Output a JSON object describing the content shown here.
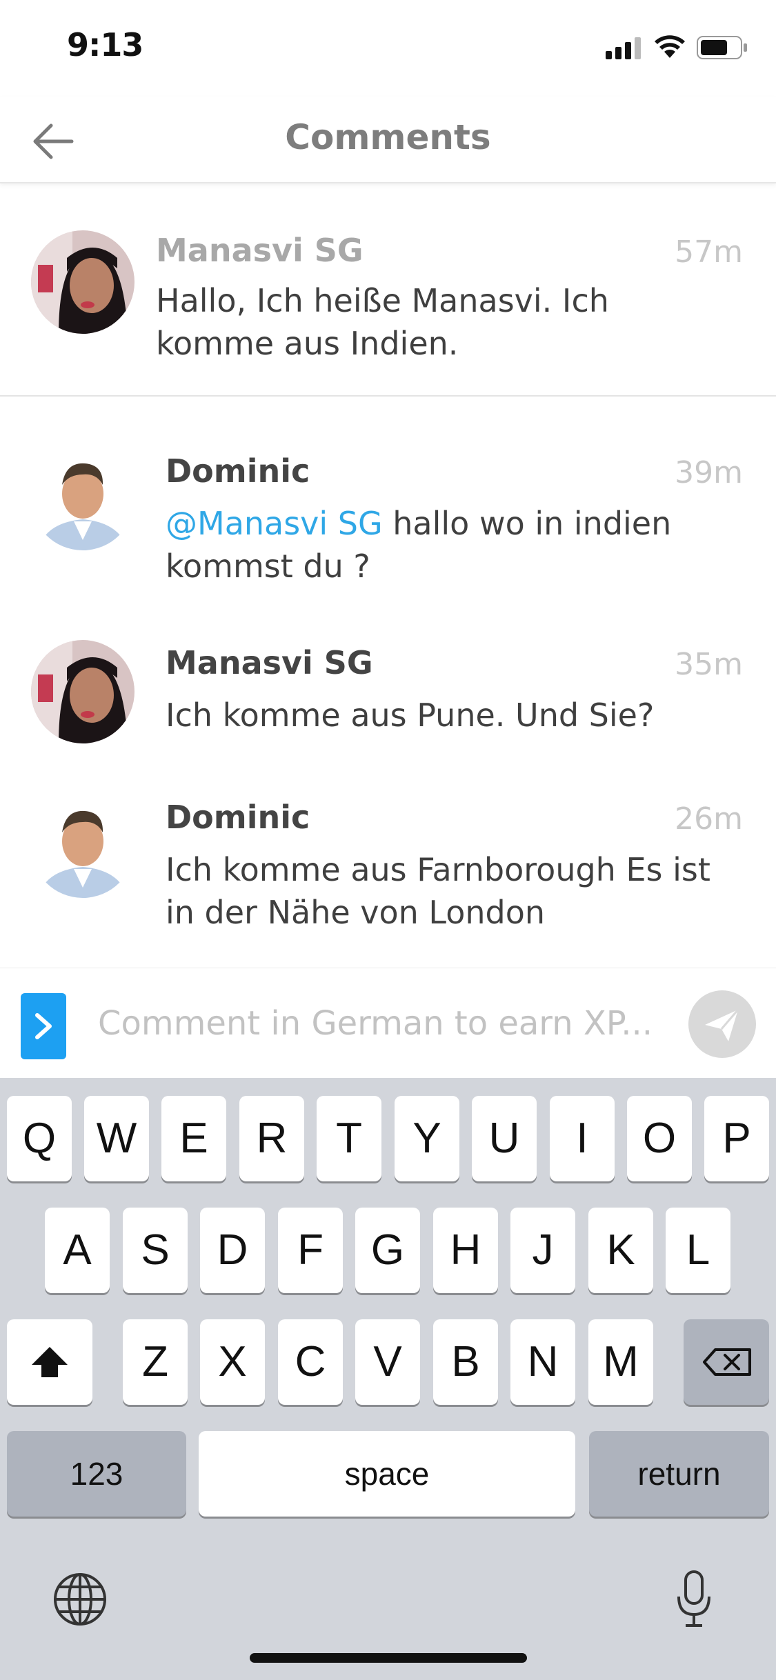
{
  "status_bar": {
    "time": "9:13"
  },
  "header": {
    "title": "Comments"
  },
  "comments": [
    {
      "author": "Manasvi SG",
      "time": "57m",
      "text_line1": "Hallo, Ich heiße Manasvi. Ich",
      "text_line2": "komme aus Indien."
    },
    {
      "author": "Dominic",
      "time": "39m",
      "mention": "@Manasvi SG",
      "text_line1": " hallo wo in indien",
      "text_line2": "kommst du ?"
    },
    {
      "author": "Manasvi SG",
      "time": "35m",
      "text_line1": "Ich komme aus Pune. Und Sie?"
    },
    {
      "author": "Dominic",
      "time": "26m",
      "text_line1": "Ich komme aus Farnborough Es ist",
      "text_line2": "in der Nähe von London"
    }
  ],
  "composer": {
    "placeholder": "Comment in German to earn XP..."
  },
  "keyboard": {
    "row1": [
      "Q",
      "W",
      "E",
      "R",
      "T",
      "Y",
      "U",
      "I",
      "O",
      "P"
    ],
    "row2": [
      "A",
      "S",
      "D",
      "F",
      "G",
      "H",
      "J",
      "K",
      "L"
    ],
    "row3": [
      "Z",
      "X",
      "C",
      "V",
      "B",
      "N",
      "M"
    ],
    "numbers_label": "123",
    "space_label": "space",
    "return_label": "return"
  },
  "colors": {
    "accent": "#1da0f2",
    "mention": "#2fa7e6",
    "keyboard_bg": "#d2d5db"
  }
}
